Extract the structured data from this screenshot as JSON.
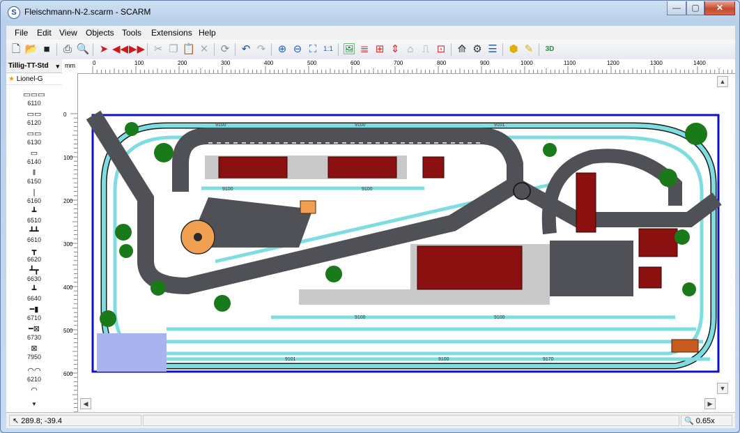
{
  "window": {
    "title": "Fleischmann-N-2.scarm - SCARM",
    "app_icon": "S",
    "min_glyph": "—",
    "max_glyph": "▢",
    "close_glyph": "✕"
  },
  "menu": [
    "File",
    "Edit",
    "View",
    "Objects",
    "Tools",
    "Extensions",
    "Help"
  ],
  "toolbar_icons": [
    "new-file-icon",
    "open-folder-icon",
    "save-icon",
    "print-icon",
    "print-preview-icon",
    "select-arrow-icon",
    "rewind-icon",
    "fast-forward-icon",
    "cut-icon",
    "copy-icon",
    "paste-icon",
    "delete-icon",
    "rotate-icon",
    "undo-icon",
    "redo-icon",
    "zoom-in-icon",
    "zoom-out-icon",
    "fit-icon",
    "zoom-1-1-icon",
    "image-icon",
    "layers-icon",
    "tracks-icon",
    "height-icon",
    "tunnel-icon",
    "bridge-icon",
    "lock-icon",
    "ruler-icon",
    "color-icon",
    "cube-icon",
    "paint-icon",
    "3d-view-icon"
  ],
  "library": {
    "selected": "Tillig-TT-Std",
    "favorite": "Lionel-G",
    "pieces": [
      "6110",
      "6120",
      "6130",
      "6140",
      "6150",
      "6160",
      "6510",
      "6610",
      "6620",
      "6630",
      "6640",
      "6710",
      "6730",
      "7950",
      "6210"
    ]
  },
  "ruler": {
    "unit": "mm",
    "h_ticks": [
      "0",
      "100",
      "200",
      "300",
      "400",
      "500",
      "600",
      "700",
      "800",
      "900",
      "1000",
      "1100",
      "1200",
      "1300",
      "1400"
    ],
    "v_ticks": [
      "0",
      "100",
      "200",
      "300",
      "400",
      "500",
      "600"
    ]
  },
  "track_labels": [
    "9100",
    "9101",
    "9170",
    "9174",
    "9175",
    "9176",
    "9179",
    "9171",
    "9172",
    "9173"
  ],
  "status": {
    "coords": "289.8; -39.4",
    "zoom": "0.65x"
  },
  "colors": {
    "track": "#7fdde2",
    "road": "#505156",
    "building_roof": "#8b1010",
    "tree": "#1a7a1a",
    "border": "#1010c8"
  }
}
